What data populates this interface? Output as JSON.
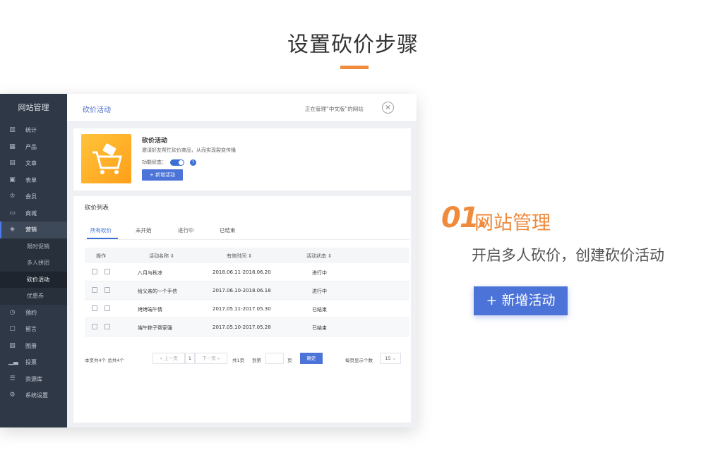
{
  "page": {
    "title": "设置砍价步骤",
    "accent": "#f08a3c"
  },
  "sidebar": {
    "title": "网站管理",
    "items": [
      {
        "label": "统计",
        "icon": "chart-icon"
      },
      {
        "label": "产品",
        "icon": "grid-icon"
      },
      {
        "label": "文章",
        "icon": "document-icon"
      },
      {
        "label": "表单",
        "icon": "form-icon"
      },
      {
        "label": "会员",
        "icon": "crown-icon"
      },
      {
        "label": "商城",
        "icon": "store-icon"
      },
      {
        "label": "营销",
        "icon": "tag-icon"
      }
    ],
    "sub_items": [
      "限时促销",
      "多人拼团",
      "砍价活动",
      "优惠券"
    ],
    "items_after": [
      {
        "label": "预约",
        "icon": "clock-icon"
      },
      {
        "label": "留言",
        "icon": "message-icon"
      },
      {
        "label": "图册",
        "icon": "image-icon"
      },
      {
        "label": "投票",
        "icon": "bar-icon"
      },
      {
        "label": "资源库",
        "icon": "database-icon"
      },
      {
        "label": "系统设置",
        "icon": "settings-icon"
      }
    ]
  },
  "topbar": {
    "breadcrumb": "砍价活动",
    "managing": "正在管理“中文版”的网站"
  },
  "feature": {
    "title": "砍价活动",
    "description": "邀请好友帮忙砍价商品，从而实现裂变传播",
    "state_label": "功能状态：",
    "add_button": "新增活动"
  },
  "list": {
    "title": "砍价列表",
    "tabs": [
      "所有砍价",
      "未开始",
      "进行中",
      "已结束"
    ],
    "columns": [
      "操作",
      "活动名称",
      "有效时间",
      "活动状态"
    ],
    "rows": [
      {
        "name": "八月与秋凉",
        "time": "2018.06.11-2018.06.20",
        "status": "进行中"
      },
      {
        "name": "给父亲的一个手信",
        "time": "2017.06.10-2018.06.18",
        "status": "进行中"
      },
      {
        "name": "烤烤端午情",
        "time": "2017.05.11-2017.05.30",
        "status": "已结束"
      },
      {
        "name": "端午粽子帮家强",
        "time": "2017.05.10-2017.05.28",
        "status": "已结束"
      }
    ]
  },
  "pager": {
    "summary": "本页共4个 总共4个",
    "prev": "上一页",
    "page": "1",
    "next": "下一页",
    "total": "共1页",
    "goto": "到第",
    "page_unit": "页",
    "confirm": "确定",
    "per_page": "每页显示个数",
    "per_page_value": "15"
  },
  "step": {
    "number": "01.",
    "title": "网站管理",
    "subtitle": "开启多人砍价，创建砍价活动",
    "button": "+ 新增活动"
  }
}
